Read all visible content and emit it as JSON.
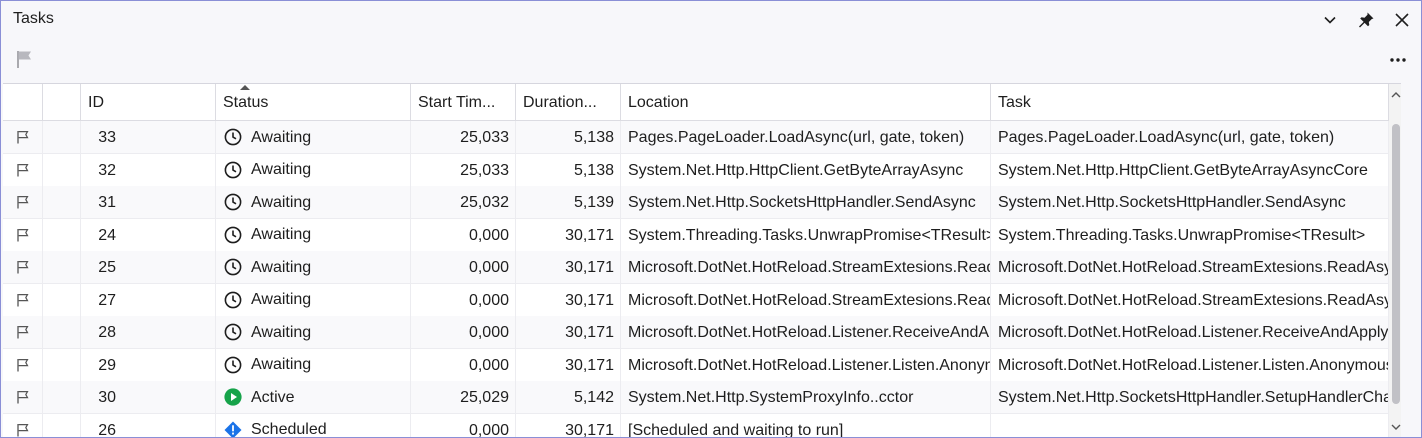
{
  "window": {
    "title": "Tasks"
  },
  "columns": [
    {
      "key": "flag",
      "label": ""
    },
    {
      "key": "blank",
      "label": ""
    },
    {
      "key": "id",
      "label": "ID"
    },
    {
      "key": "status",
      "label": "Status"
    },
    {
      "key": "start",
      "label": "Start Tim..."
    },
    {
      "key": "duration",
      "label": "Duration..."
    },
    {
      "key": "location",
      "label": "Location"
    },
    {
      "key": "task",
      "label": "Task"
    }
  ],
  "rows": [
    {
      "id": "33",
      "status": "Awaiting",
      "status_icon": "clock-icon",
      "start": "25,033",
      "duration": "5,138",
      "location": "Pages.PageLoader.LoadAsync(url, gate, token)",
      "task": "Pages.PageLoader.LoadAsync(url, gate, token)"
    },
    {
      "id": "32",
      "status": "Awaiting",
      "status_icon": "clock-icon",
      "start": "25,033",
      "duration": "5,138",
      "location": "System.Net.Http.HttpClient.GetByteArrayAsync",
      "task": "System.Net.Http.HttpClient.GetByteArrayAsyncCore"
    },
    {
      "id": "31",
      "status": "Awaiting",
      "status_icon": "clock-icon",
      "start": "25,032",
      "duration": "5,139",
      "location": "System.Net.Http.SocketsHttpHandler.SendAsync",
      "task": "System.Net.Http.SocketsHttpHandler.SendAsync"
    },
    {
      "id": "24",
      "status": "Awaiting",
      "status_icon": "clock-icon",
      "start": "0,000",
      "duration": "30,171",
      "location": "System.Threading.Tasks.UnwrapPromise<TResult>",
      "task": "System.Threading.Tasks.UnwrapPromise<TResult>"
    },
    {
      "id": "25",
      "status": "Awaiting",
      "status_icon": "clock-icon",
      "start": "0,000",
      "duration": "30,171",
      "location": "Microsoft.DotNet.HotReload.StreamExtesions.ReadAsync",
      "task": "Microsoft.DotNet.HotReload.StreamExtesions.ReadAsync"
    },
    {
      "id": "27",
      "status": "Awaiting",
      "status_icon": "clock-icon",
      "start": "0,000",
      "duration": "30,171",
      "location": "Microsoft.DotNet.HotReload.StreamExtesions.ReadAsync",
      "task": "Microsoft.DotNet.HotReload.StreamExtesions.ReadAsync"
    },
    {
      "id": "28",
      "status": "Awaiting",
      "status_icon": "clock-icon",
      "start": "0,000",
      "duration": "30,171",
      "location": "Microsoft.DotNet.HotReload.Listener.ReceiveAndApply",
      "task": "Microsoft.DotNet.HotReload.Listener.ReceiveAndApply"
    },
    {
      "id": "29",
      "status": "Awaiting",
      "status_icon": "clock-icon",
      "start": "0,000",
      "duration": "30,171",
      "location": "Microsoft.DotNet.HotReload.Listener.Listen.AnonymousMethod",
      "task": "Microsoft.DotNet.HotReload.Listener.Listen.AnonymousMethod"
    },
    {
      "id": "30",
      "status": "Active",
      "status_icon": "play-circle-icon",
      "start": "25,029",
      "duration": "5,142",
      "location": "System.Net.Http.SystemProxyInfo..cctor",
      "task": "System.Net.Http.SocketsHttpHandler.SetupHandlerChain"
    },
    {
      "id": "26",
      "status": "Scheduled",
      "status_icon": "info-diamond-icon",
      "start": "0,000",
      "duration": "30,171",
      "location": "[Scheduled and waiting to run]",
      "task": ""
    }
  ],
  "colors": {
    "accent": "#8a8fd6",
    "active": "#16a34a",
    "scheduled": "#1a73e8"
  }
}
